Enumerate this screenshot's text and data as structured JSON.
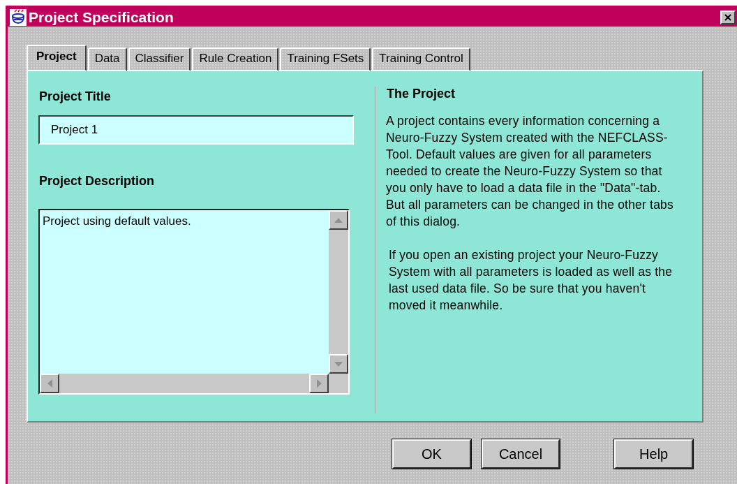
{
  "window": {
    "title": "Project Specification"
  },
  "tabs": [
    {
      "label": "Project",
      "selected": true
    },
    {
      "label": "Data",
      "selected": false
    },
    {
      "label": "Classifier",
      "selected": false
    },
    {
      "label": "Rule Creation",
      "selected": false
    },
    {
      "label": "Training FSets",
      "selected": false
    },
    {
      "label": "Training Control",
      "selected": false
    }
  ],
  "project_title": {
    "label": "Project Title",
    "value": "Project 1"
  },
  "project_description": {
    "label": "Project Description",
    "value": "Project using default values."
  },
  "info": {
    "heading": "The Project",
    "paragraphs": [
      "A project contains every information concerning a Neuro-Fuzzy System created with the NEFCLASS-Tool.  Default values are given for all parameters needed to create the Neuro-Fuzzy System so that you only have to load a data file in the \"Data\"-tab.  But all parameters can be changed in the other tabs of this dialog.",
      "If you open an existing project your Neuro-Fuzzy System with all parameters is loaded as well as the last used data file. So be sure that you haven't moved it meanwhile."
    ]
  },
  "buttons": [
    {
      "label": "OK",
      "kind": "ok"
    },
    {
      "label": "Cancel",
      "kind": "cancel"
    },
    {
      "label": "Help",
      "kind": "help"
    }
  ]
}
